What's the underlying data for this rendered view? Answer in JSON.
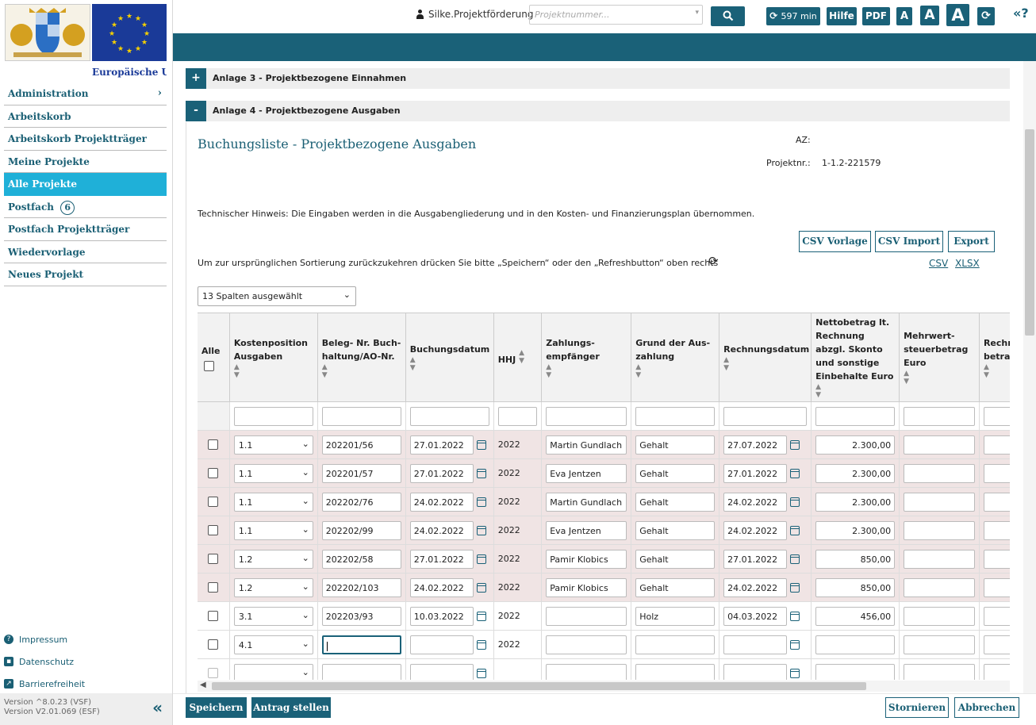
{
  "sidebar": {
    "logo_text": "Europäische Uni",
    "items": [
      {
        "label": "Administration",
        "has_chevron": true
      },
      {
        "label": "Arbeitskorb"
      },
      {
        "label": "Arbeitskorb Projektträger"
      },
      {
        "label": "Meine Projekte"
      },
      {
        "label": "Alle Projekte",
        "active": true
      },
      {
        "label": "Postfach",
        "badge": "6"
      },
      {
        "label": "Postfach Projektträger"
      },
      {
        "label": "Wiedervorlage"
      },
      {
        "label": "Neues Projekt"
      }
    ],
    "footer_links": [
      "Impressum",
      "Datenschutz",
      "Barrierefreiheit"
    ],
    "version_lines": [
      "Version ^8.0.23 (VSF)",
      "Version V2.01.069 (ESF)"
    ]
  },
  "topbar": {
    "user": "Silke.Projektförderung",
    "search_placeholder": "Projektnummer...",
    "timer": "597 min",
    "help": "Hilfe",
    "pdf": "PDF",
    "font_sizes": [
      "A",
      "A",
      "A"
    ]
  },
  "accordions": [
    {
      "icon": "+",
      "label": "Anlage 3 - Projektbezogene Einnahmen"
    },
    {
      "icon": "-",
      "label": "Anlage 4 - Projektbezogene Ausgaben"
    }
  ],
  "panel": {
    "title": "Buchungsliste - Projektbezogene Ausgaben",
    "az_label": "AZ:",
    "projnr_label": "Projektnr.:",
    "projnr_value": "1-1.2-221579",
    "hint": "Technischer Hinweis: Die Eingaben werden in die Ausgabengliederung und in den Kosten- und Finanzierungsplan übernommen.",
    "buttons": [
      "CSV Vorlage",
      "CSV Import",
      "Export"
    ],
    "sort_note": "Um zur ursprünglichen Sortierung zurückzukehren drücken Sie bitte „Speichern“ oder den „Refreshbutton“ oben rechts",
    "export_links": [
      "CSV",
      "XLSX"
    ],
    "column_select": "13 Spalten ausgewählt"
  },
  "table": {
    "headers": [
      "Alle",
      "Kostenposition Ausgaben",
      "Beleg- Nr. Buch-haltung/AO-Nr.",
      "Buchungsdatum",
      "HHJ",
      "Zahlungs-empfänger",
      "Grund der Aus-zahlung",
      "Rechnungsdatum",
      "Nettobetrag lt. Rechnung abzgl. Skonto und sonstige Einbehalte Euro",
      "Mehrwert-steuerbetrag Euro",
      "Rechnungs-betrag"
    ],
    "rows": [
      {
        "kp": "1.1",
        "beleg": "202201/56",
        "buchung": "27.01.2022",
        "hhj": "2022",
        "empf": "Martin Gundlach",
        "grund": "Gehalt",
        "rdatum": "27.07.2022",
        "netto": "2.300,00",
        "shaded": true
      },
      {
        "kp": "1.1",
        "beleg": "202201/57",
        "buchung": "27.01.2022",
        "hhj": "2022",
        "empf": "Eva Jentzen",
        "grund": "Gehalt",
        "rdatum": "27.01.2022",
        "netto": "2.300,00",
        "shaded": true
      },
      {
        "kp": "1.1",
        "beleg": "202202/76",
        "buchung": "24.02.2022",
        "hhj": "2022",
        "empf": "Martin Gundlach",
        "grund": "Gehalt",
        "rdatum": "24.02.2022",
        "netto": "2.300,00",
        "shaded": true
      },
      {
        "kp": "1.1",
        "beleg": "202202/99",
        "buchung": "24.02.2022",
        "hhj": "2022",
        "empf": "Eva Jentzen",
        "grund": "Gehalt",
        "rdatum": "24.02.2022",
        "netto": "2.300,00",
        "shaded": true
      },
      {
        "kp": "1.2",
        "beleg": "202202/58",
        "buchung": "27.01.2022",
        "hhj": "2022",
        "empf": "Pamir Klobics",
        "grund": "Gehalt",
        "rdatum": "27.01.2022",
        "netto": "850,00",
        "shaded": true
      },
      {
        "kp": "1.2",
        "beleg": "202202/103",
        "buchung": "24.02.2022",
        "hhj": "2022",
        "empf": "Pamir Klobics",
        "grund": "Gehalt",
        "rdatum": "24.02.2022",
        "netto": "850,00",
        "shaded": true
      },
      {
        "kp": "3.1",
        "beleg": "202203/93",
        "buchung": "10.03.2022",
        "hhj": "2022",
        "empf": "",
        "grund": "Holz",
        "rdatum": "04.03.2022",
        "netto": "456,00",
        "shaded": false
      },
      {
        "kp": "4.1",
        "beleg": "",
        "buchung": "",
        "hhj": "2022",
        "empf": "",
        "grund": "",
        "rdatum": "",
        "netto": "",
        "shaded": false,
        "focus": true
      },
      {
        "kp": "",
        "beleg": "",
        "buchung": "",
        "hhj": "",
        "empf": "",
        "grund": "",
        "rdatum": "",
        "netto": "",
        "shaded": false,
        "disabled": true
      }
    ]
  },
  "bottom": {
    "save": "Speichern",
    "submit": "Antrag stellen",
    "cancel": "Stornieren",
    "abort": "Abbrechen"
  }
}
